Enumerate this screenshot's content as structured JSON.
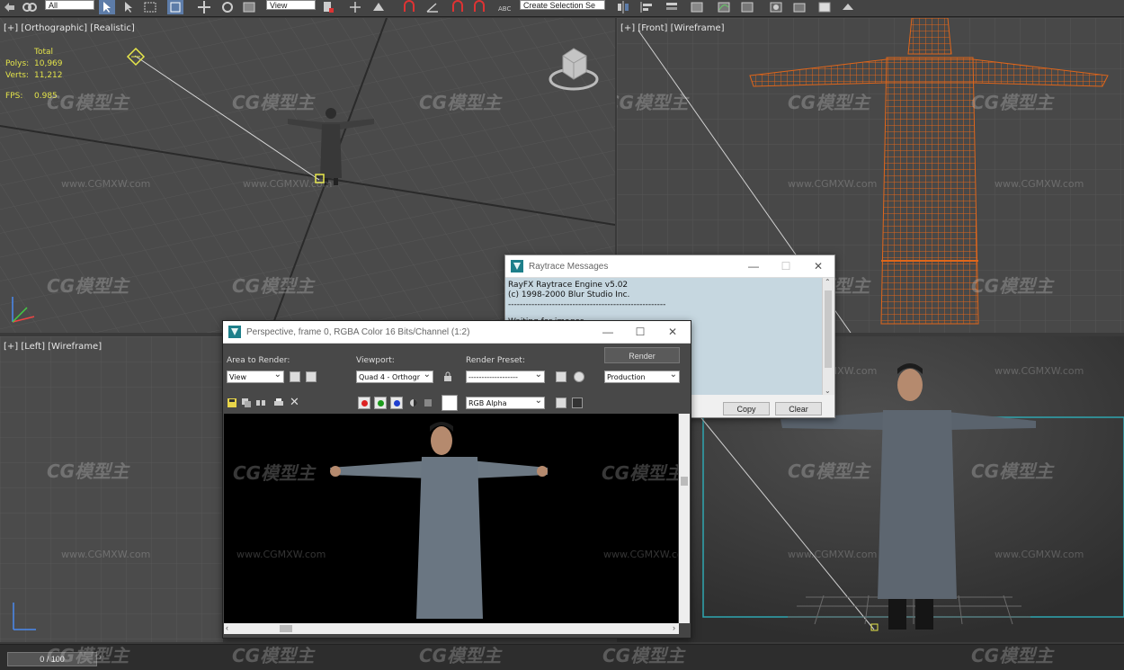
{
  "toolbar": {
    "selection_filter": "All",
    "reference_coord": "View",
    "named_selection": "Create Selection Se"
  },
  "viewports": {
    "top_left": {
      "label": "[+] [Orthographic] [Realistic]",
      "stats": {
        "header": "Total",
        "polys_label": "Polys:",
        "polys_value": "10,969",
        "verts_label": "Verts:",
        "verts_value": "11,212",
        "fps_label": "FPS:",
        "fps_value": "0.985"
      }
    },
    "top_right": {
      "label": "[+] [Front] [Wireframe]"
    },
    "bottom_left": {
      "label": "[+] [Left] [Wireframe]"
    }
  },
  "watermark": {
    "logo": "CG模型主",
    "url": "www.CGMXW.com"
  },
  "raytrace_window": {
    "title": "Raytrace Messages",
    "lines": [
      "RayFX Raytrace Engine v5.02",
      "(c) 1998-2000 Blur Studio Inc.",
      "------------------------------------------------------",
      "Waiting for images ..."
    ],
    "copy_label": "Copy",
    "clear_label": "Clear"
  },
  "frame_window": {
    "title": "Perspective, frame 0, RGBA Color 16 Bits/Channel (1:2)",
    "area_label": "Area to Render:",
    "area_value": "View",
    "viewport_label": "Viewport:",
    "viewport_value": "Quad 4 - Orthogr",
    "preset_label": "Render Preset:",
    "preset_value": "-------------------",
    "render_label": "Render",
    "production_value": "Production",
    "channel_value": "RGB Alpha"
  },
  "timeline": {
    "frame_display": "0 / 100"
  },
  "colors": {
    "wireframe": "#e0661a",
    "stats": "#e3e34a",
    "raytrace_bg": "#c6d7e0",
    "gown": "#5d6670"
  }
}
